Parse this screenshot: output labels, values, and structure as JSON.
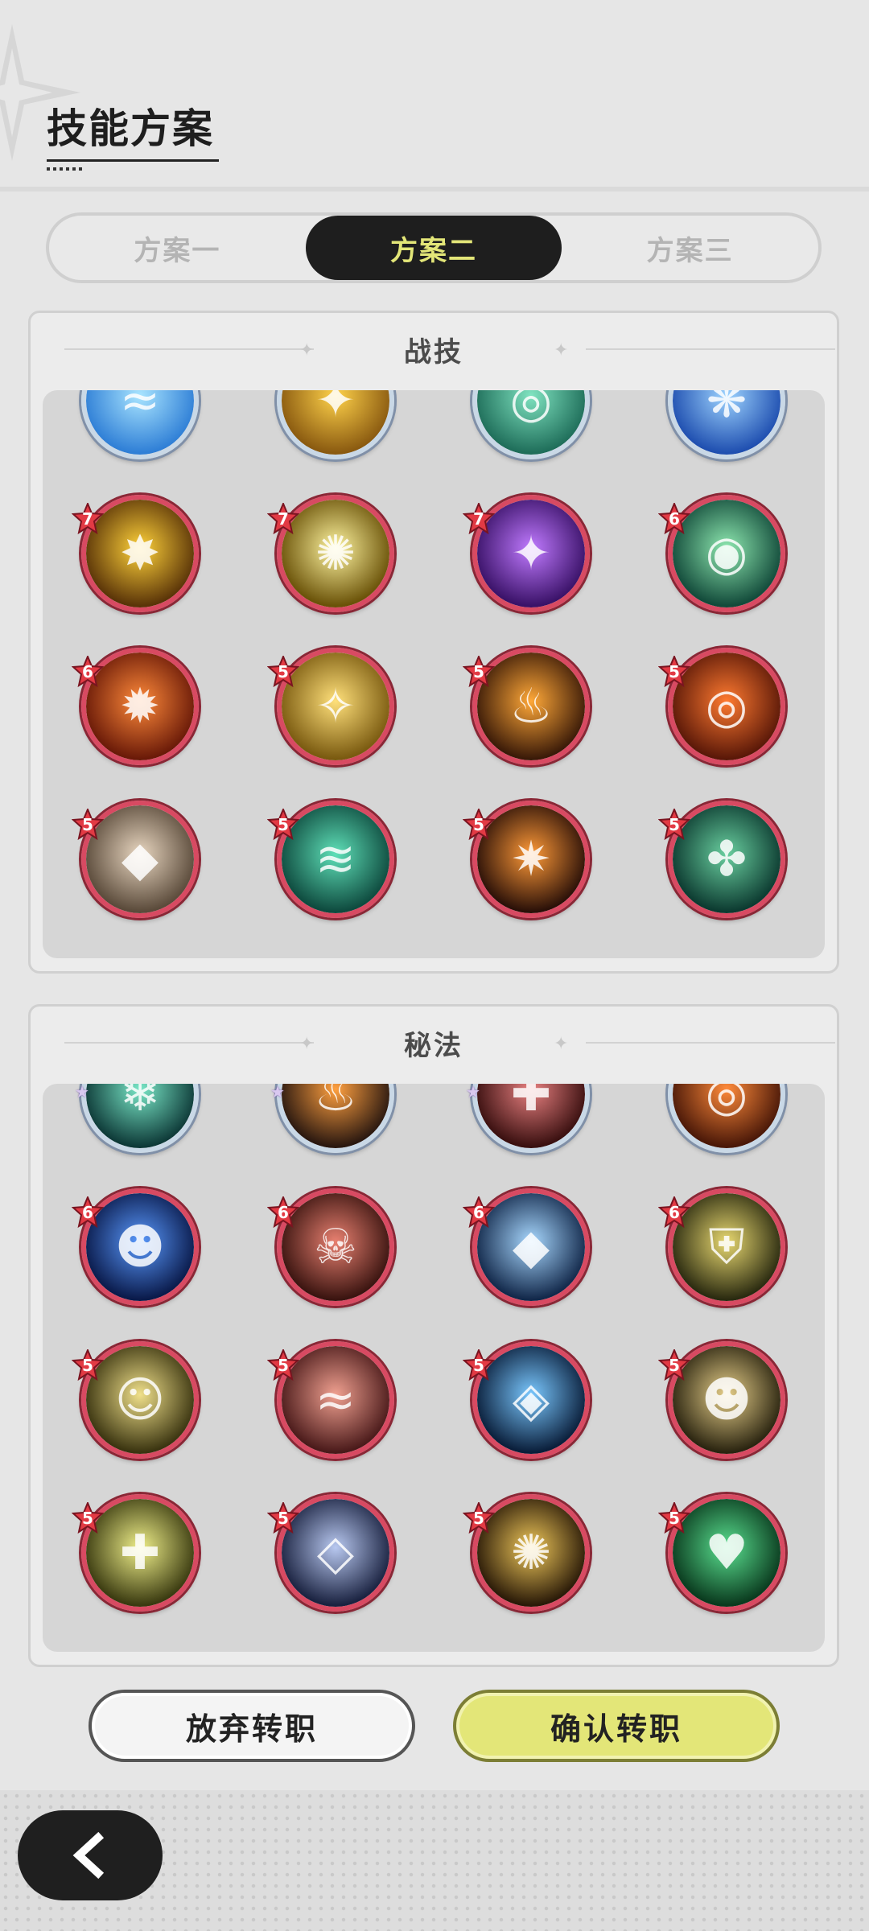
{
  "header": {
    "title": "技能方案"
  },
  "tabs": [
    {
      "label": "方案一",
      "active": false
    },
    {
      "label": "方案二",
      "active": true
    },
    {
      "label": "方案三",
      "active": false
    }
  ],
  "colors": {
    "active_tab_bg": "#1e1e1e",
    "active_tab_text": "#e3e678",
    "confirm_button": "#e3e678",
    "skill_ring": "#d84a62"
  },
  "combat_section": {
    "title": "战技",
    "skills": [
      {
        "name": "water-wave-icon",
        "badge": "",
        "colors": [
          "#2f7fd6",
          "#a8e4ff"
        ],
        "glyph": "≈"
      },
      {
        "name": "golden-crack-icon",
        "badge": "",
        "colors": [
          "#8a5a10",
          "#ffd24a"
        ],
        "glyph": "✦"
      },
      {
        "name": "green-swirl-icon",
        "badge": "",
        "colors": [
          "#1f6e5a",
          "#7fe3c0"
        ],
        "glyph": "◎"
      },
      {
        "name": "blue-burst-icon",
        "badge": "",
        "colors": [
          "#1f4fb0",
          "#9ed4ff"
        ],
        "glyph": "❋"
      },
      {
        "name": "golden-explosion-icon",
        "badge": "7",
        "colors": [
          "#5a3408",
          "#ffd23a"
        ],
        "glyph": "✸"
      },
      {
        "name": "sun-flash-icon",
        "badge": "7",
        "colors": [
          "#6a5208",
          "#fff5a0"
        ],
        "glyph": "✺"
      },
      {
        "name": "purple-vortex-icon",
        "badge": "7",
        "colors": [
          "#3a1268",
          "#c07aff"
        ],
        "glyph": "✦"
      },
      {
        "name": "green-sphere-icon",
        "badge": "6",
        "colors": [
          "#124a3a",
          "#8ee8b0"
        ],
        "glyph": "◉"
      },
      {
        "name": "fire-orb-icon",
        "badge": "6",
        "colors": [
          "#6a1a08",
          "#ff8a3a"
        ],
        "glyph": "✹"
      },
      {
        "name": "light-slash-icon",
        "badge": "5",
        "colors": [
          "#7a5a10",
          "#ffe07a"
        ],
        "glyph": "✧"
      },
      {
        "name": "flame-spirit-icon",
        "badge": "5",
        "colors": [
          "#3a1a08",
          "#ffa838"
        ],
        "glyph": "♨"
      },
      {
        "name": "fire-spiral-icon",
        "badge": "5",
        "colors": [
          "#5a1808",
          "#ff7a30"
        ],
        "glyph": "◎"
      },
      {
        "name": "stone-shard-icon",
        "badge": "5",
        "colors": [
          "#5a4a3a",
          "#e8d6c0"
        ],
        "glyph": "◆"
      },
      {
        "name": "green-wind-icon",
        "badge": "5",
        "colors": [
          "#0e4a3e",
          "#5fe0b8"
        ],
        "glyph": "≋"
      },
      {
        "name": "fire-comet-icon",
        "badge": "5",
        "colors": [
          "#2a1008",
          "#ff9a38"
        ],
        "glyph": "✷"
      },
      {
        "name": "thorn-vine-icon",
        "badge": "5",
        "colors": [
          "#0c3a30",
          "#6ad0a0"
        ],
        "glyph": "✤"
      }
    ]
  },
  "secret_section": {
    "title": "秘法",
    "skills": [
      {
        "name": "ice-crystal-icon",
        "badge": "",
        "stars": 4,
        "colors": [
          "#0e3a38",
          "#7ae8c8"
        ],
        "glyph": "❄"
      },
      {
        "name": "flame-cat-icon",
        "badge": "",
        "stars": 4,
        "colors": [
          "#2a1810",
          "#ffa040"
        ],
        "glyph": "♨"
      },
      {
        "name": "blood-pulse-icon",
        "badge": "",
        "stars": 4,
        "colors": [
          "#3a1010",
          "#e88080"
        ],
        "glyph": "✚"
      },
      {
        "name": "ember-ring-icon",
        "badge": "",
        "stars": 0,
        "colors": [
          "#4a1808",
          "#ff8a3a"
        ],
        "glyph": "◎"
      },
      {
        "name": "blue-spirit-icon",
        "badge": "6",
        "colors": [
          "#0a1a4a",
          "#5a9aff"
        ],
        "glyph": "☻"
      },
      {
        "name": "demon-face-icon",
        "badge": "6",
        "colors": [
          "#3a1410",
          "#e88070"
        ],
        "glyph": "☠"
      },
      {
        "name": "ice-shard-icon",
        "badge": "6",
        "colors": [
          "#12284a",
          "#a8d8ff"
        ],
        "glyph": "◆"
      },
      {
        "name": "golden-shield-icon",
        "badge": "6",
        "colors": [
          "#2a2a10",
          "#e8d870"
        ],
        "glyph": "⛨"
      },
      {
        "name": "light-figure-icon",
        "badge": "5",
        "colors": [
          "#3a3410",
          "#f0e08a"
        ],
        "glyph": "☺"
      },
      {
        "name": "crimson-wave-icon",
        "badge": "5",
        "colors": [
          "#4a1a1a",
          "#f0a090"
        ],
        "glyph": "≈"
      },
      {
        "name": "water-drop-icon",
        "badge": "5",
        "colors": [
          "#0a1e3a",
          "#7ac8ff"
        ],
        "glyph": "◈"
      },
      {
        "name": "rising-figure-icon",
        "badge": "5",
        "colors": [
          "#2a2410",
          "#e8d08a"
        ],
        "glyph": "☻"
      },
      {
        "name": "heal-figure-icon",
        "badge": "5",
        "colors": [
          "#3a3a10",
          "#f0f08a"
        ],
        "glyph": "✚"
      },
      {
        "name": "crystal-armor-icon",
        "badge": "5",
        "colors": [
          "#1a2240",
          "#b8c8f0"
        ],
        "glyph": "◇"
      },
      {
        "name": "golden-nest-icon",
        "badge": "5",
        "colors": [
          "#2a1a08",
          "#f0c85a"
        ],
        "glyph": "✺"
      },
      {
        "name": "green-heart-icon",
        "badge": "5",
        "colors": [
          "#0a3a1e",
          "#5ae090"
        ],
        "glyph": "♥"
      }
    ]
  },
  "buttons": {
    "abandon": "放弃转职",
    "confirm": "确认转职"
  }
}
